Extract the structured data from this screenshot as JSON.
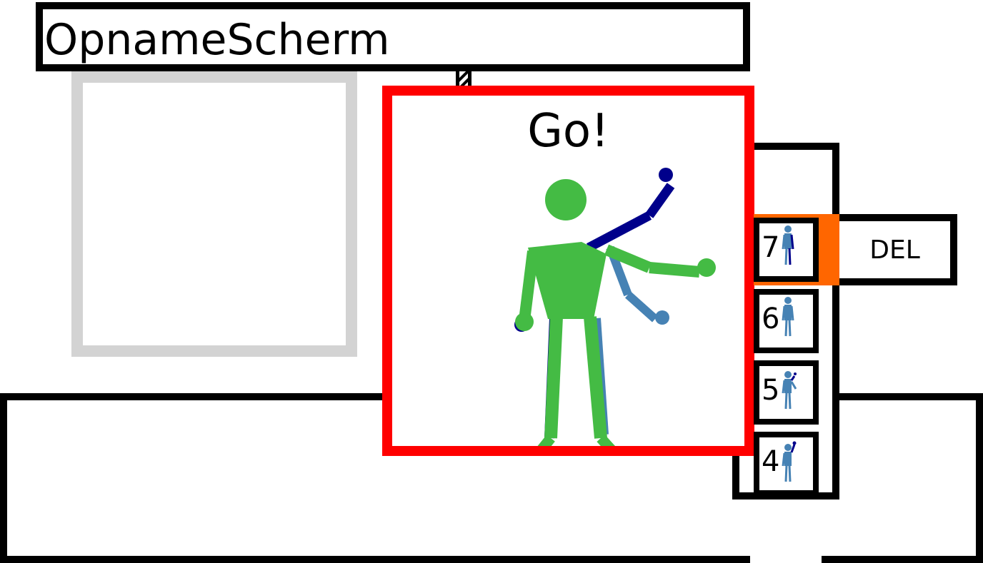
{
  "header": {
    "title": "OpnameScherm"
  },
  "recorder": {
    "prompt": "Go!"
  },
  "actions": {
    "delete_label": "DEL"
  },
  "poses": [
    {
      "number": "7",
      "selected": true
    },
    {
      "number": "6",
      "selected": false
    },
    {
      "number": "5",
      "selected": false
    },
    {
      "number": "4",
      "selected": false
    }
  ],
  "colors": {
    "record_border": "#ff0000",
    "selection": "#ff6600",
    "live_skeleton": "#44bb44",
    "target_skeleton": "#4682b4",
    "secondary_skeleton": "#00008b",
    "preview_border": "#d3d3d3"
  }
}
